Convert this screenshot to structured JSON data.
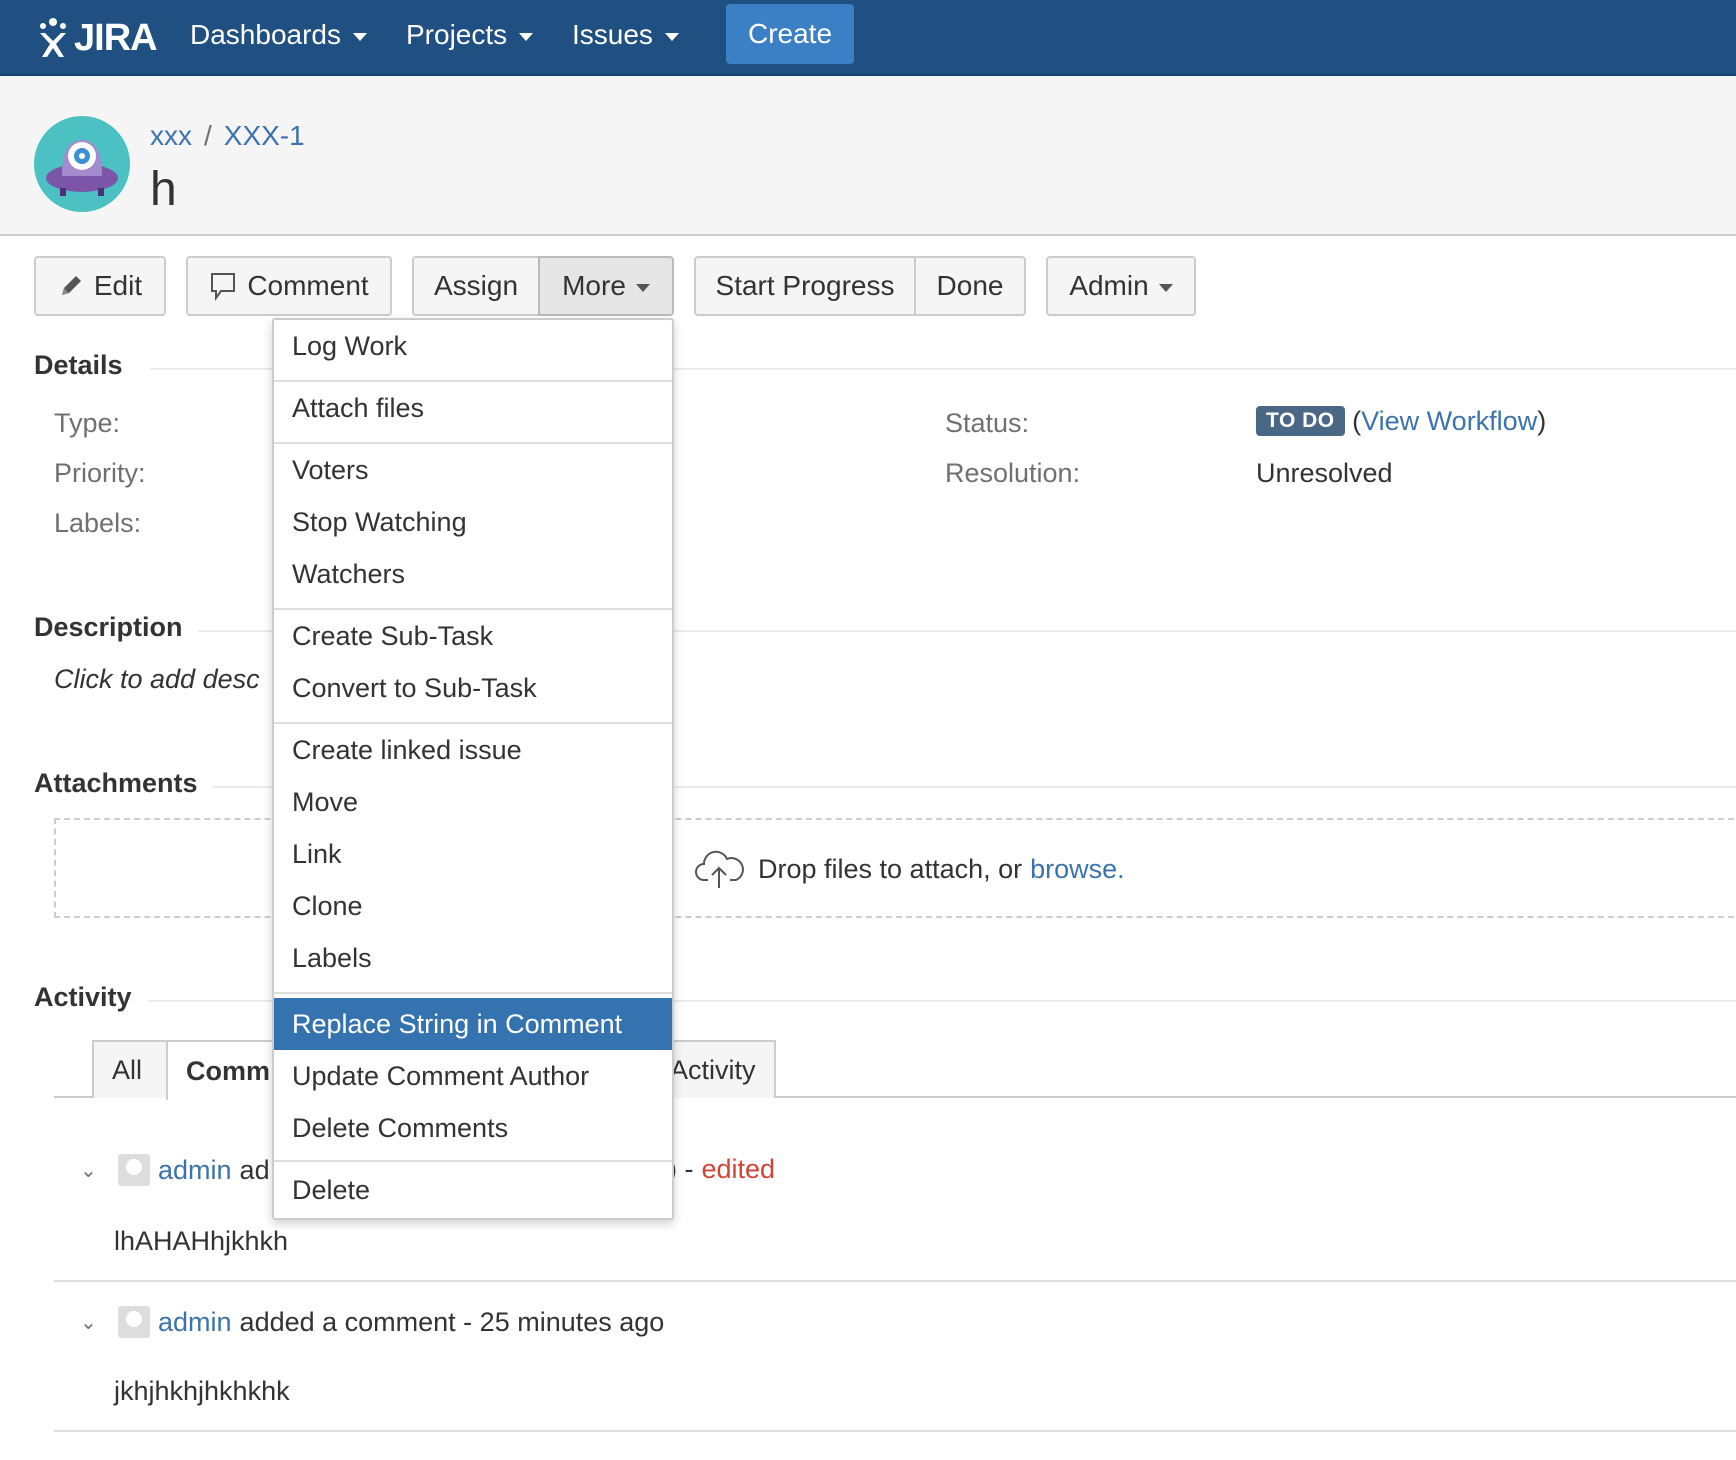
{
  "nav": {
    "logo": "JIRA",
    "items": [
      "Dashboards",
      "Projects",
      "Issues"
    ],
    "create": "Create"
  },
  "header": {
    "project": "xxx",
    "separator": "/",
    "issue_key": "XXX-1",
    "title": "h"
  },
  "toolbar": {
    "edit": "Edit",
    "comment": "Comment",
    "assign": "Assign",
    "more": "More",
    "start_progress": "Start Progress",
    "done": "Done",
    "admin": "Admin"
  },
  "details": {
    "title": "Details",
    "type_label": "Type:",
    "priority_label": "Priority:",
    "labels_label": "Labels:",
    "status_label": "Status:",
    "status_value": "TO DO",
    "view_workflow": "View Workflow",
    "resolution_label": "Resolution:",
    "resolution_value": "Unresolved"
  },
  "description": {
    "title": "Description",
    "placeholder": "Click to add desc"
  },
  "attachments": {
    "title": "Attachments",
    "drop_text": "Drop files to attach, or",
    "browse": "browse."
  },
  "activity": {
    "title": "Activity",
    "tabs": [
      "All",
      "Comm",
      "Activity"
    ],
    "comments": [
      {
        "author": "admin",
        "action_visible": "ad",
        "suffix": ") -",
        "edited": "edited",
        "body": "lhAHAHhjkhkh"
      },
      {
        "author": "admin",
        "action": "added a comment - 25 minutes ago",
        "body": "jkhjhkhjhkhkhk"
      }
    ]
  },
  "more_menu": {
    "groups": [
      [
        "Log Work"
      ],
      [
        "Attach files"
      ],
      [
        "Voters",
        "Stop Watching",
        "Watchers"
      ],
      [
        "Create Sub-Task",
        "Convert to Sub-Task"
      ],
      [
        "Create linked issue",
        "Move",
        "Link",
        "Clone",
        "Labels"
      ],
      [
        "Replace String in Comment",
        "Update Comment Author",
        "Delete Comments"
      ],
      [
        "Delete"
      ]
    ],
    "highlighted": "Replace String in Comment"
  },
  "colors": {
    "nav_bg": "#205081",
    "create_bg": "#3b7fc4",
    "link": "#3b73af",
    "lozenge": "#4a6785",
    "highlight": "#3572b0",
    "edited": "#d04437"
  }
}
